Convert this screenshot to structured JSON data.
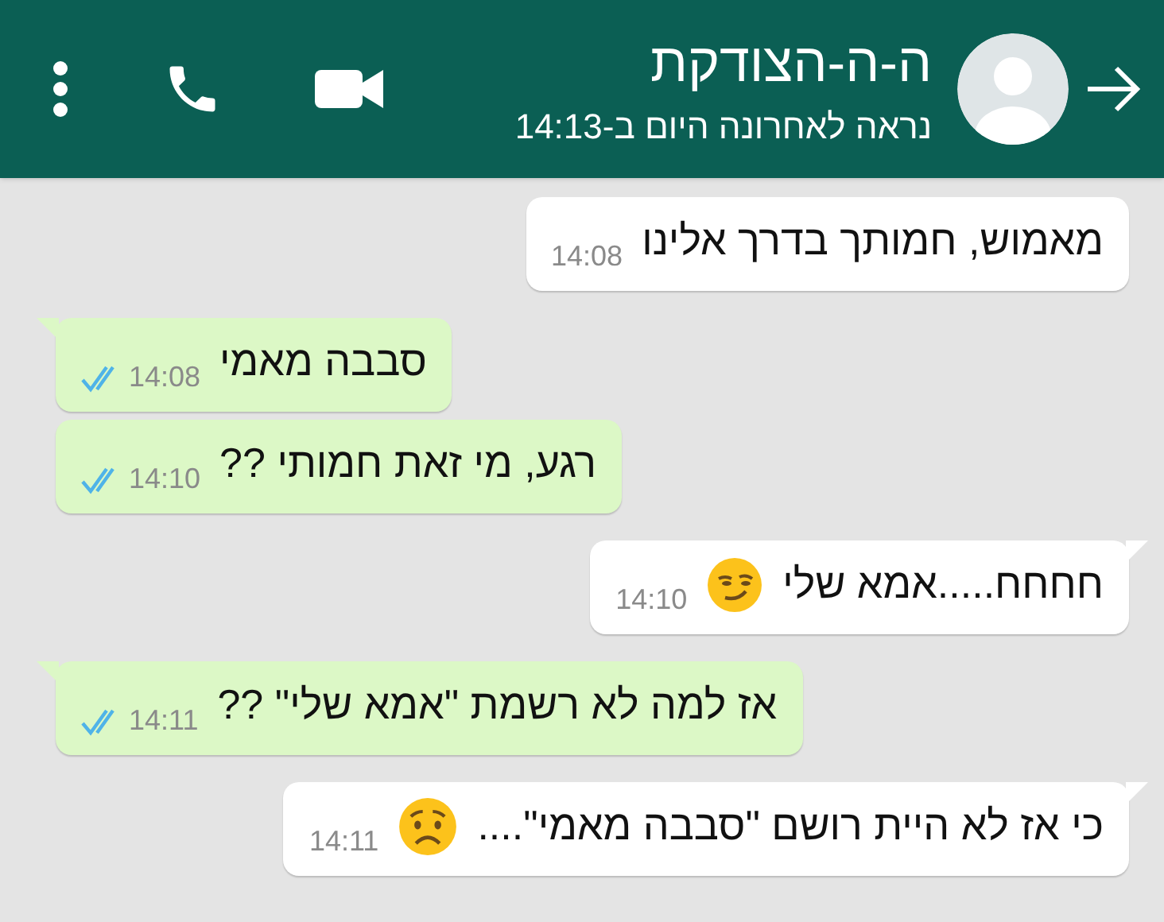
{
  "header": {
    "title": "ה-ה-הצודקת",
    "subtitle": "נראה לאחרונה היום ב-14:13"
  },
  "messages": [
    {
      "kind": "incoming",
      "tail": false,
      "text": "מאמוש, חמותך בדרך אלינו",
      "time": "14:08"
    },
    {
      "kind": "outgoing",
      "tail": true,
      "text": "סבבה מאמי",
      "time": "14:08",
      "read": true
    },
    {
      "kind": "outgoing",
      "tail": false,
      "text": "רגע, מי זאת חמותי ??",
      "time": "14:10",
      "read": true
    },
    {
      "kind": "incoming",
      "tail": true,
      "text": "חחחח.....אמא שלי",
      "emoji": {
        "kind": "smirk"
      },
      "time": "14:10"
    },
    {
      "kind": "outgoing",
      "tail": true,
      "text": "אז למה לא רשמת \"אמא שלי\" ??",
      "time": "14:11",
      "read": true
    },
    {
      "kind": "incoming",
      "tail": true,
      "text": "כי אז לא היית רושם \"סבבה מאמי\"....",
      "emoji": {
        "kind": "worried"
      },
      "time": "14:11"
    }
  ]
}
